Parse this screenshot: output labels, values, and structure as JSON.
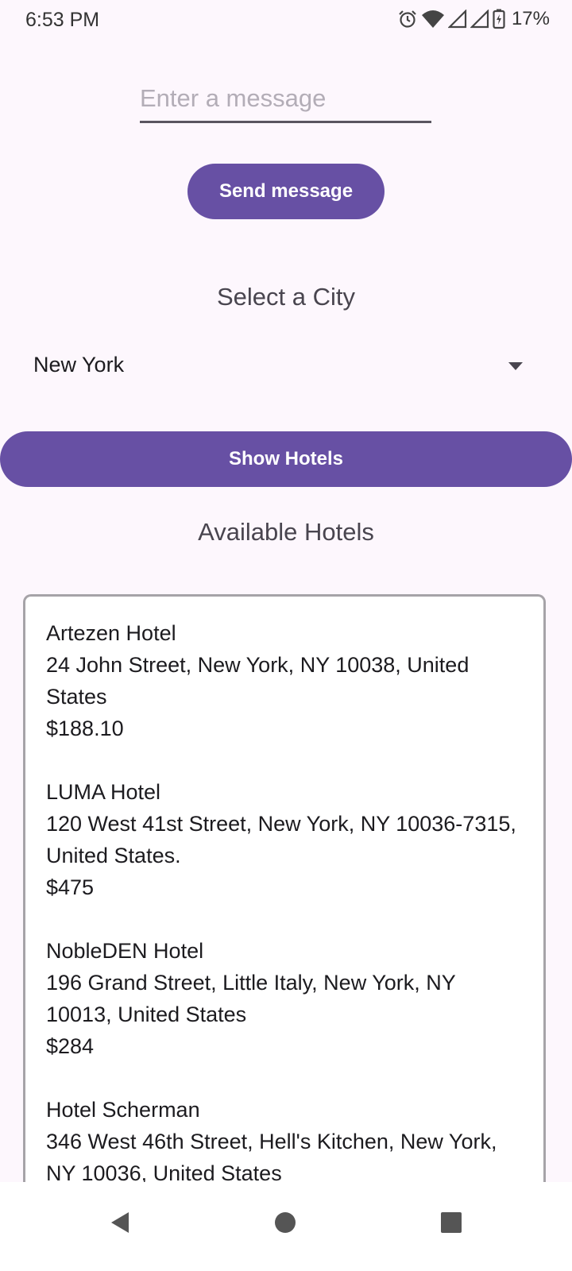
{
  "status_bar": {
    "time": "6:53 PM",
    "battery": "17%",
    "icons": [
      "alarm-icon",
      "wifi-icon",
      "signal-icon",
      "signal-icon",
      "battery-charging-icon"
    ]
  },
  "message": {
    "placeholder": "Enter a message",
    "value": "",
    "send_label": "Send message"
  },
  "city": {
    "title": "Select a City",
    "selected": "New York",
    "show_label": "Show Hotels"
  },
  "hotels": {
    "title": "Available Hotels",
    "items": [
      {
        "name": "Artezen Hotel",
        "address": "24 John Street, New York, NY 10038, United States",
        "price": "$188.10"
      },
      {
        "name": "LUMA Hotel",
        "address": "120 West 41st Street, New York, NY 10036-7315, United States.",
        "price": "$475"
      },
      {
        "name": "NobleDEN Hotel",
        "address": "196 Grand Street, Little Italy, New York, NY 10013, United States",
        "price": "$284"
      },
      {
        "name": "Hotel Scherman",
        "address": "346 West 46th Street, Hell's Kitchen, New York, NY 10036, United States",
        "price": ""
      }
    ]
  },
  "colors": {
    "accent": "#6750a4",
    "background": "#fdf7fd"
  },
  "nav": {
    "icons": [
      "back-icon",
      "home-icon",
      "recents-icon"
    ]
  }
}
